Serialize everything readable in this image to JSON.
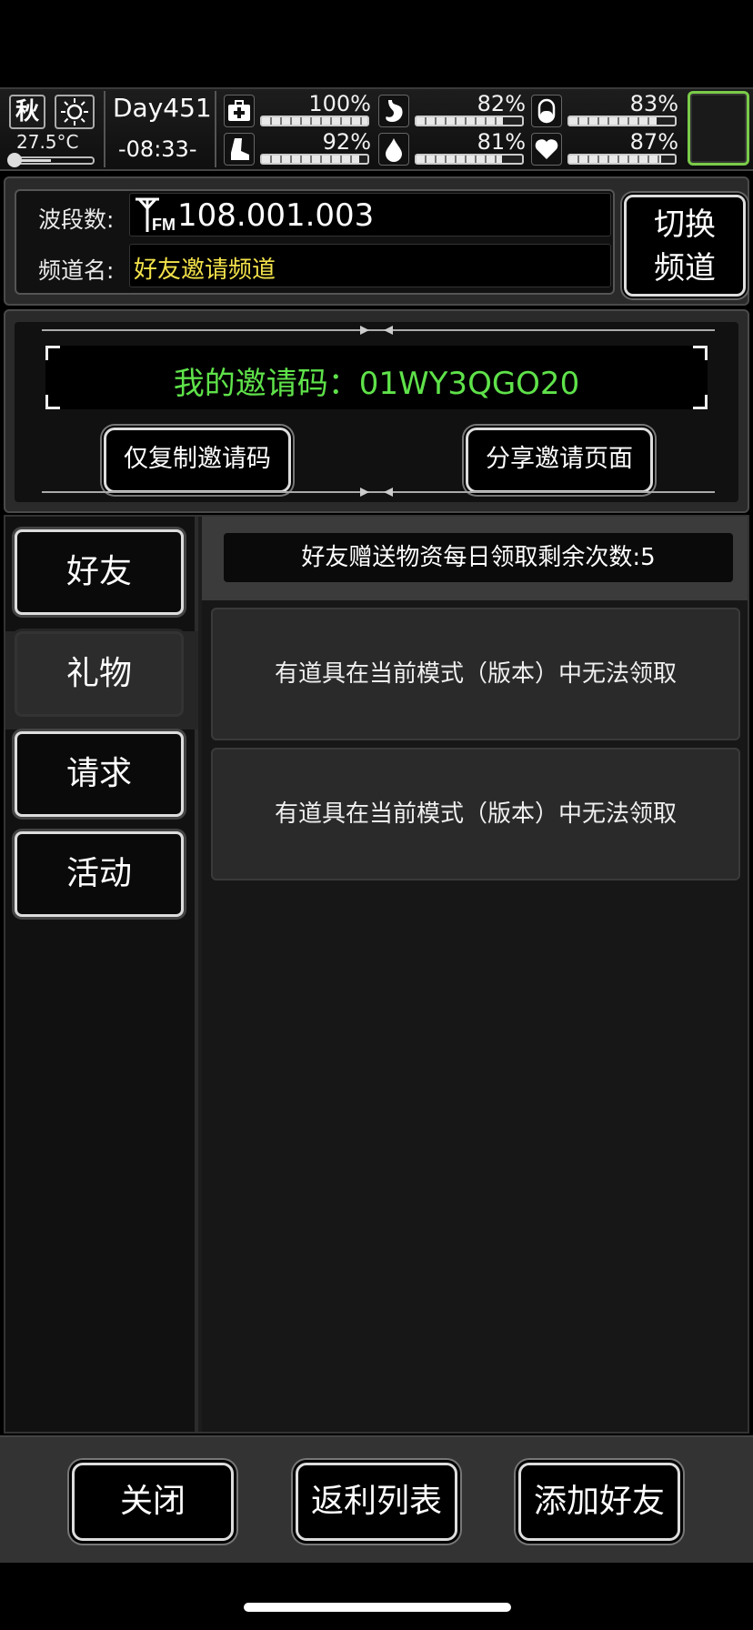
{
  "hud": {
    "season": "秋",
    "temperature": "27.5°C",
    "day": "Day451",
    "clock": "-08:33-",
    "stats": [
      {
        "icon": "medkit-icon",
        "pct_label": "100%",
        "value": 100
      },
      {
        "icon": "stomach-icon",
        "pct_label": "82%",
        "value": 82
      },
      {
        "icon": "pill-icon",
        "pct_label": "83%",
        "value": 83
      },
      {
        "icon": "boot-icon",
        "pct_label": "92%",
        "value": 92
      },
      {
        "icon": "water-drop-icon",
        "pct_label": "81%",
        "value": 81
      },
      {
        "icon": "heart-icon",
        "pct_label": "87%",
        "value": 87
      }
    ]
  },
  "radio": {
    "band_label": "波段数:",
    "frequency": "108.001.003",
    "channel_label": "频道名:",
    "channel_name": "好友邀请频道",
    "switch_label_1": "切换",
    "switch_label_2": "频道"
  },
  "invite": {
    "code_text": "我的邀请码：01WY3QGO20",
    "copy_button": "仅复制邀请码",
    "share_button": "分享邀请页面"
  },
  "tabs": [
    {
      "label": "好友",
      "active": false
    },
    {
      "label": "礼物",
      "active": true
    },
    {
      "label": "请求",
      "active": false
    },
    {
      "label": "活动",
      "active": false
    }
  ],
  "gifts": {
    "remaining_text": "好友赠送物资每日领取剩余次数:5",
    "items": [
      "有道具在当前模式（版本）中无法领取",
      "有道具在当前模式（版本）中无法领取"
    ]
  },
  "bottom": {
    "close": "关闭",
    "rebate_list": "返利列表",
    "add_friend": "添加好友"
  }
}
